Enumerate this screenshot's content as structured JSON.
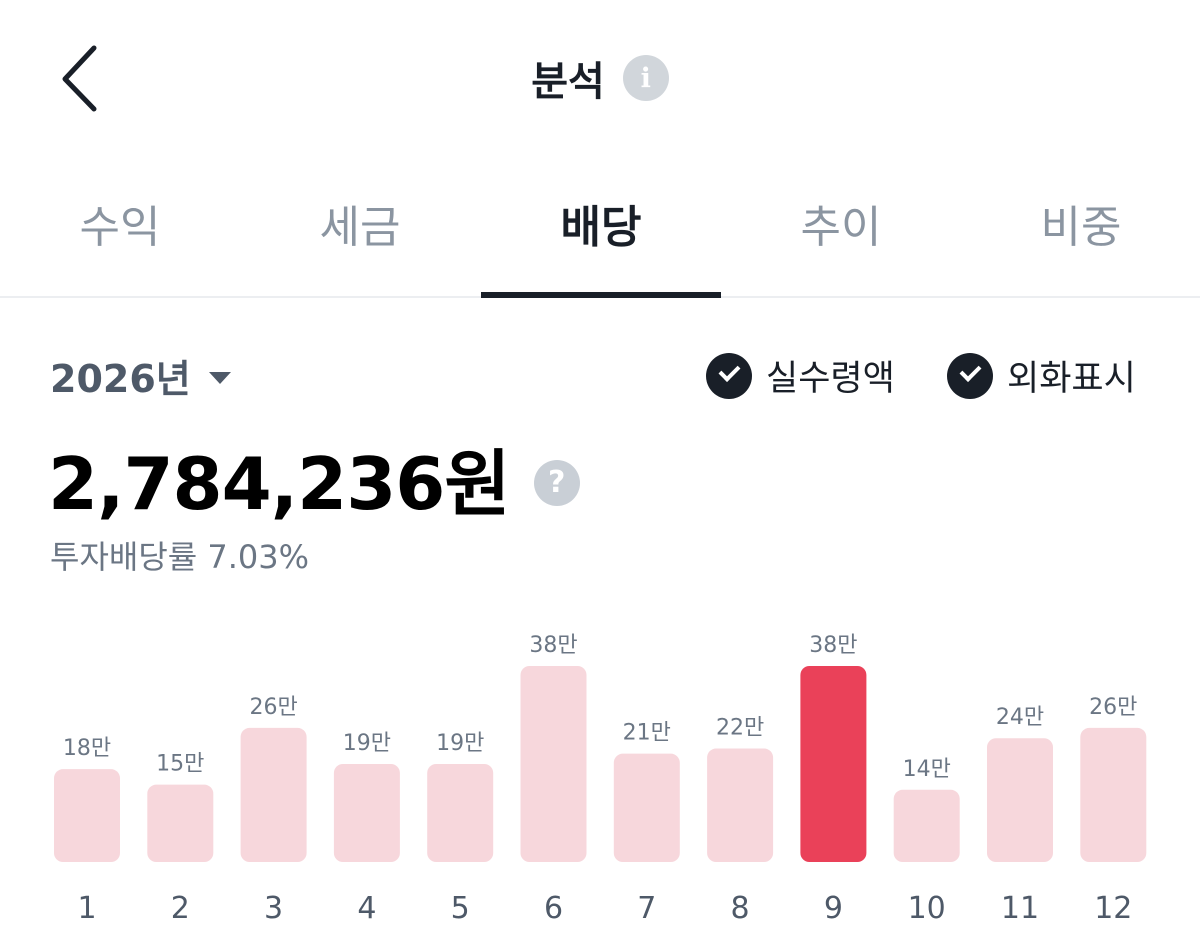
{
  "header": {
    "title": "분석"
  },
  "tabs": [
    {
      "label": "수익",
      "active": false
    },
    {
      "label": "세금",
      "active": false
    },
    {
      "label": "배당",
      "active": true
    },
    {
      "label": "추이",
      "active": false
    },
    {
      "label": "비중",
      "active": false
    }
  ],
  "filters": {
    "year": "2026년",
    "toggle_net": "실수령액",
    "toggle_fx": "외화표시"
  },
  "summary": {
    "amount": "2,784,236원",
    "yield_text": "투자배당률 7.03%"
  },
  "colors": {
    "bar": "#f7d7dc",
    "bar_highlight": "#ea4159",
    "label": "#6b7684",
    "month": "#4e5968"
  },
  "chart_data": {
    "type": "bar",
    "categories": [
      "1",
      "2",
      "3",
      "4",
      "5",
      "6",
      "7",
      "8",
      "9",
      "10",
      "11",
      "12"
    ],
    "values": [
      18,
      15,
      26,
      19,
      19,
      38,
      21,
      22,
      38,
      14,
      24,
      26
    ],
    "labels": [
      "18만",
      "15만",
      "26만",
      "19만",
      "19만",
      "38만",
      "21만",
      "22만",
      "38만",
      "14만",
      "24만",
      "26만"
    ],
    "highlight_category": "9",
    "ylim": [
      0,
      38
    ]
  }
}
